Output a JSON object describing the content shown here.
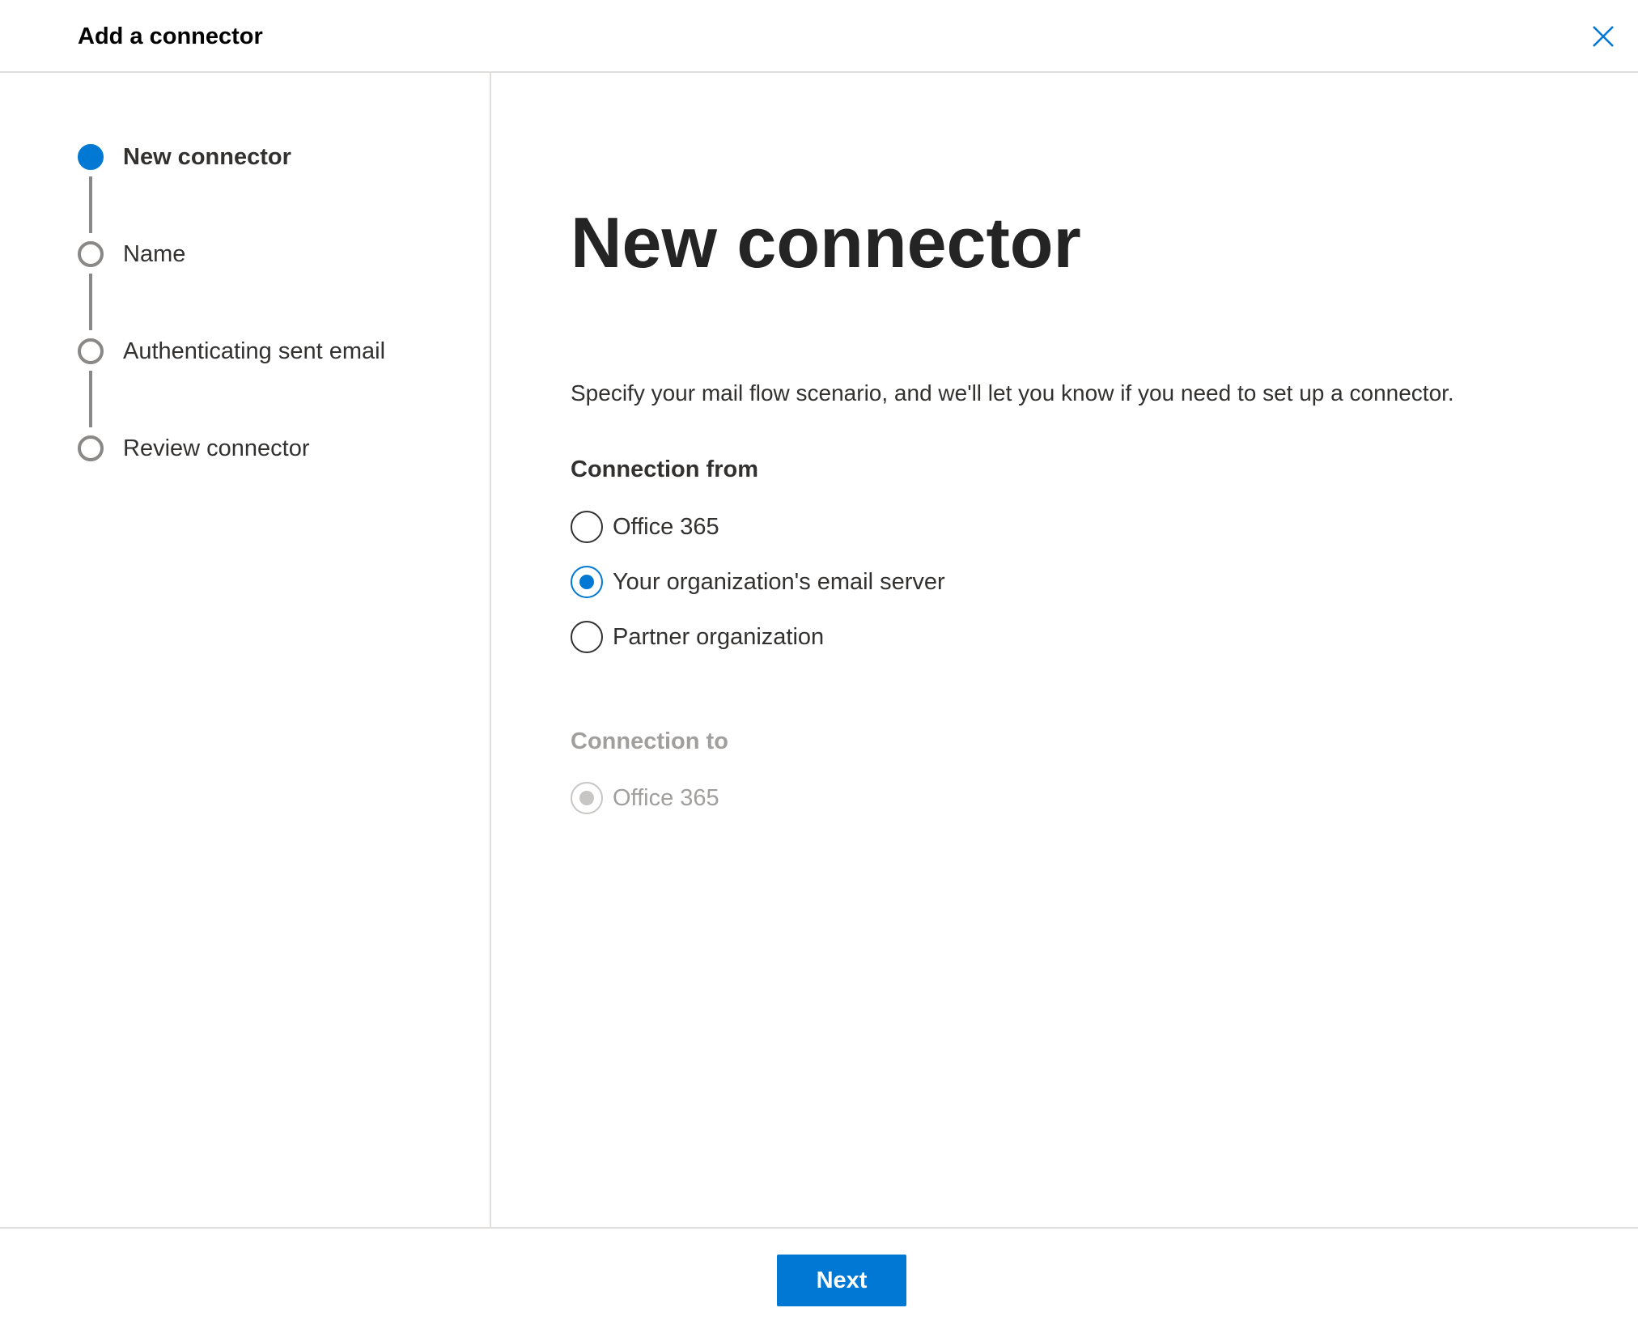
{
  "header": {
    "title": "Add a connector",
    "close_icon": "close-icon"
  },
  "steps": [
    {
      "label": "New connector",
      "state": "current"
    },
    {
      "label": "Name",
      "state": "pending"
    },
    {
      "label": "Authenticating sent email",
      "state": "pending"
    },
    {
      "label": "Review connector",
      "state": "pending"
    }
  ],
  "main": {
    "title": "New connector",
    "description": "Specify your mail flow scenario, and we'll let you know if you need to set up a connector.",
    "connection_from": {
      "label": "Connection from",
      "options": [
        {
          "label": "Office 365",
          "checked": false
        },
        {
          "label": "Your organization's email server",
          "checked": true
        },
        {
          "label": "Partner organization",
          "checked": false
        }
      ]
    },
    "connection_to": {
      "label": "Connection to",
      "disabled": true,
      "options": [
        {
          "label": "Office 365",
          "checked": true
        }
      ]
    }
  },
  "footer": {
    "next_label": "Next"
  },
  "colors": {
    "accent": "#0078d4",
    "text": "#323130",
    "disabled": "#a19f9d",
    "divider": "#e1dfdd"
  }
}
